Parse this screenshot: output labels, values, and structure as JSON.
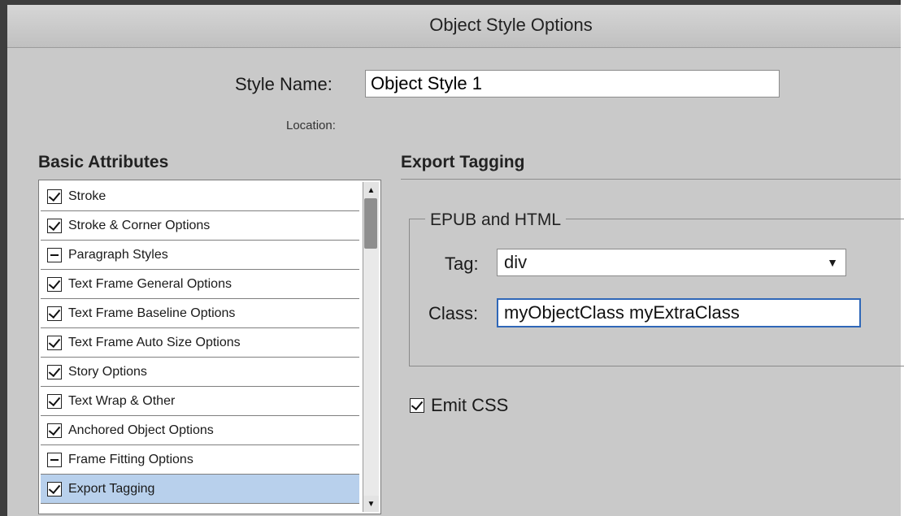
{
  "window": {
    "title": "Object Style Options"
  },
  "style_name": {
    "label": "Style Name:",
    "value": "Object Style 1"
  },
  "location": {
    "label": "Location:"
  },
  "basic_attributes": {
    "heading": "Basic Attributes",
    "items": [
      {
        "label": "Stroke",
        "state": "checked"
      },
      {
        "label": "Stroke & Corner Options",
        "state": "checked"
      },
      {
        "label": "Paragraph Styles",
        "state": "mixed"
      },
      {
        "label": "Text Frame General Options",
        "state": "checked"
      },
      {
        "label": "Text Frame Baseline Options",
        "state": "checked"
      },
      {
        "label": "Text Frame Auto Size Options",
        "state": "checked"
      },
      {
        "label": "Story Options",
        "state": "checked"
      },
      {
        "label": "Text Wrap & Other",
        "state": "checked"
      },
      {
        "label": "Anchored Object Options",
        "state": "checked"
      },
      {
        "label": "Frame Fitting Options",
        "state": "mixed"
      },
      {
        "label": "Export Tagging",
        "state": "checked",
        "selected": true
      }
    ]
  },
  "export_tagging": {
    "heading": "Export Tagging",
    "group_title": "EPUB and HTML",
    "tag": {
      "label": "Tag:",
      "value": "div"
    },
    "class": {
      "label": "Class:",
      "value": "myObjectClass myExtraClass"
    },
    "emit_css": {
      "label": "Emit CSS",
      "checked": true
    }
  },
  "colors": {
    "selection": "#b8d0ec",
    "focus_ring": "#2f67b8",
    "panel": "#c9c9c9"
  }
}
